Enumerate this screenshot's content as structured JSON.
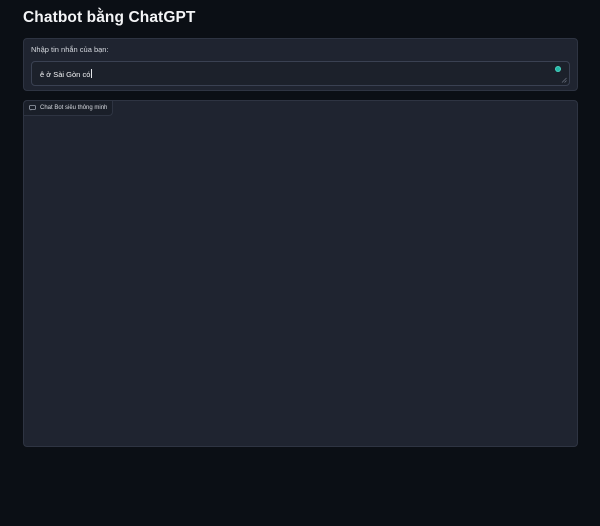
{
  "app": {
    "title": "Chatbot bằng ChatGPT"
  },
  "input": {
    "label": "Nhập tin nhắn của bạn:",
    "value": "ê ở Sài Gòn có"
  },
  "chatbot": {
    "label": "Chat Bot siêu thông minh",
    "messages": []
  },
  "colors": {
    "background": "#0b0f15",
    "panel": "#1f2430",
    "accent": "#22b8a6"
  },
  "icons": {
    "chat_label_icon": "chat-bubble-icon",
    "status_icon": "status-dot-icon",
    "resize_icon": "resize-grip-icon"
  }
}
